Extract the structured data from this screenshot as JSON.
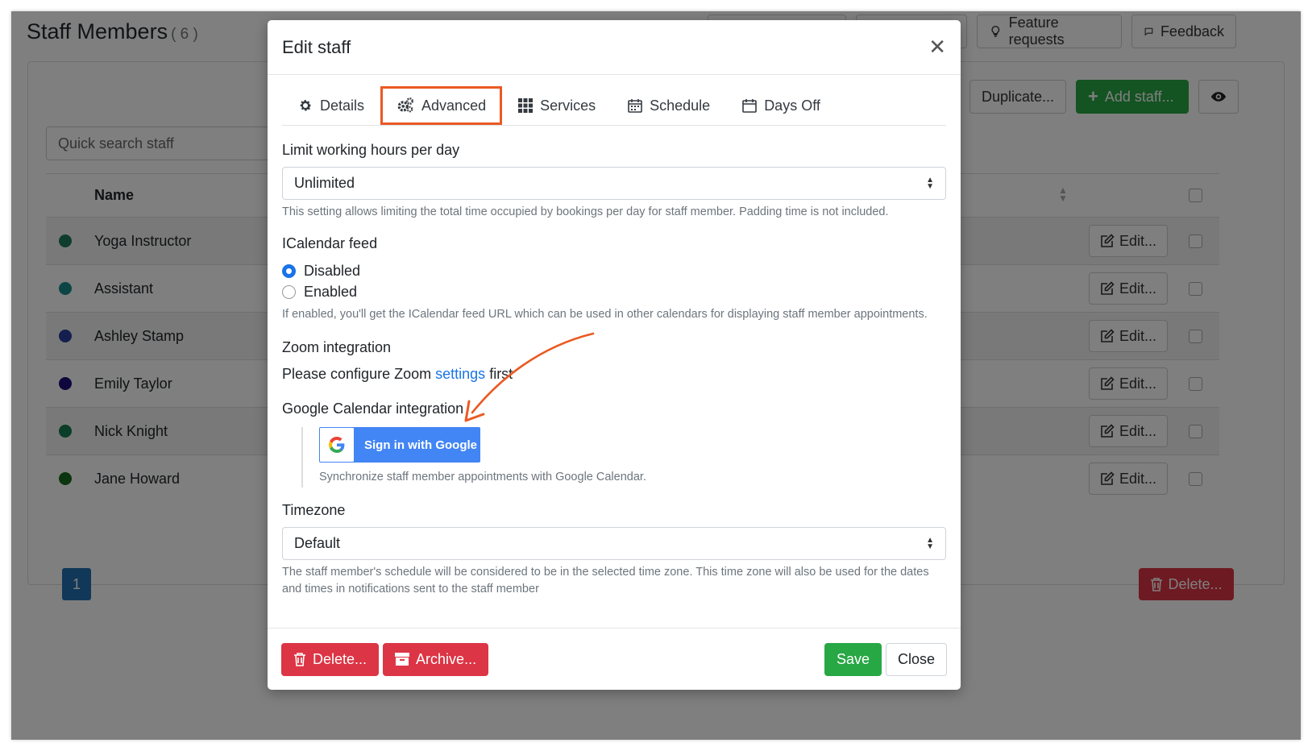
{
  "page": {
    "title": "Staff Members",
    "count": "( 6 )",
    "feature_requests_label": "Feature requests",
    "feedback_label": "Feedback",
    "search_placeholder": "Quick search staff",
    "duplicate_label": "Duplicate...",
    "add_staff_label": "Add staff...",
    "name_column": "Name",
    "edit_label": "Edit...",
    "delete_label": "Delete...",
    "page_number": "1",
    "staff": [
      {
        "name": "Yoga Instructor",
        "color": "#1e7b5a"
      },
      {
        "name": "Assistant",
        "color": "#1a8a8a"
      },
      {
        "name": "Ashley Stamp",
        "color": "#2b3f9e"
      },
      {
        "name": "Emily Taylor",
        "color": "#1c0f7a"
      },
      {
        "name": "Nick Knight",
        "color": "#177a52"
      },
      {
        "name": "Jane Howard",
        "color": "#176b1f"
      }
    ]
  },
  "modal": {
    "title": "Edit staff",
    "tabs": [
      {
        "label": "Details",
        "icon": "gear-icon"
      },
      {
        "label": "Advanced",
        "icon": "gears-icon"
      },
      {
        "label": "Services",
        "icon": "grid-icon"
      },
      {
        "label": "Schedule",
        "icon": "calendar-icon"
      },
      {
        "label": "Days Off",
        "icon": "calendar-blank-icon"
      }
    ],
    "active_tab": "Advanced",
    "limit_label": "Limit working hours per day",
    "limit_value": "Unlimited",
    "limit_help": "This setting allows limiting the total time occupied by bookings per day for staff member. Padding time is not included.",
    "ical_label": "ICalendar feed",
    "ical_options": [
      "Disabled",
      "Enabled"
    ],
    "ical_selected": "Disabled",
    "ical_help": "If enabled, you'll get the ICalendar feed URL which can be used in other calendars for displaying staff member appointments.",
    "zoom_label": "Zoom integration",
    "zoom_text_before": "Please configure Zoom",
    "zoom_link": "settings",
    "zoom_text_after": "first",
    "gcal_label": "Google Calendar integration",
    "google_button": "Sign in with Google",
    "gcal_help": "Synchronize staff member appointments with Google Calendar.",
    "timezone_label": "Timezone",
    "timezone_value": "Default",
    "timezone_help": "The staff member's schedule will be considered to be in the selected time zone. This time zone will also be used for the dates and times in notifications sent to the staff member",
    "delete_label": "Delete...",
    "archive_label": "Archive...",
    "save_label": "Save",
    "close_label": "Close"
  },
  "colors": {
    "highlight": "#ea5a23",
    "primary": "#1a73e8",
    "success": "#28a745",
    "danger": "#dc3545",
    "google_blue": "#4285f4"
  }
}
